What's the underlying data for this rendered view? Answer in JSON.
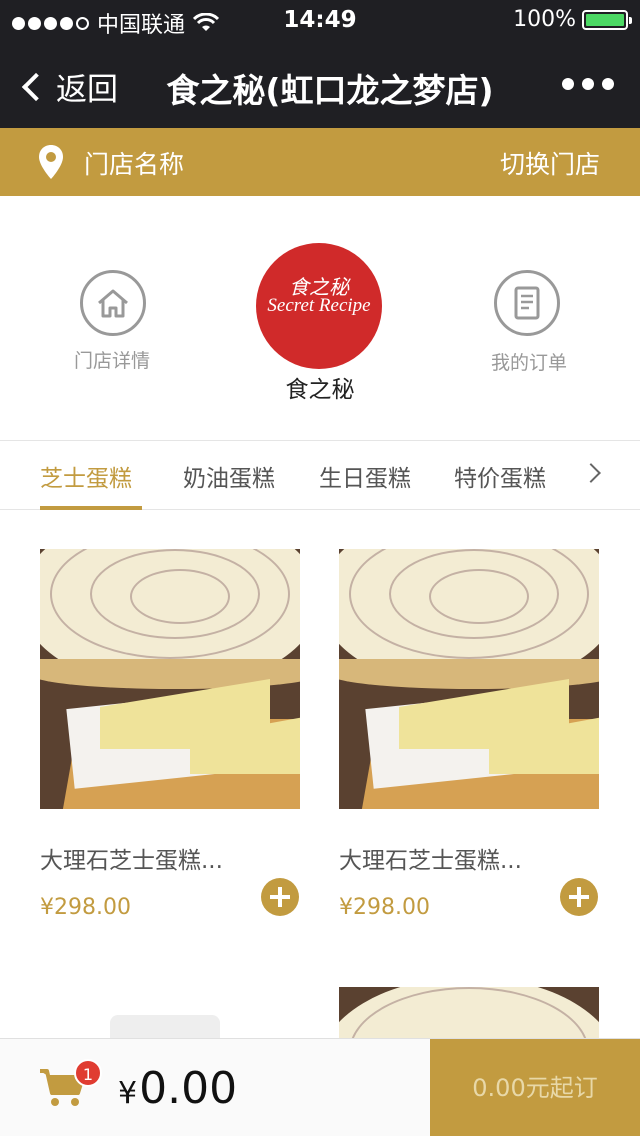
{
  "status_bar": {
    "carrier": "中国联通",
    "time": "14:49",
    "battery": "100%",
    "signal_bars": 4
  },
  "nav": {
    "back_label": "返回",
    "title": "食之秘(虹口龙之梦店)"
  },
  "store_bar": {
    "store_name": "门店名称",
    "switch_label": "切换门店"
  },
  "header": {
    "store_detail_label": "门店详情",
    "my_orders_label": "我的订单",
    "logo_cn": "食之秘",
    "logo_en": "Secret Recipe",
    "brand_name": "食之秘"
  },
  "tabs": [
    {
      "label": "芝士蛋糕",
      "active": true
    },
    {
      "label": "奶油蛋糕",
      "active": false
    },
    {
      "label": "生日蛋糕",
      "active": false
    },
    {
      "label": "特价蛋糕",
      "active": false
    }
  ],
  "products": [
    {
      "name": "大理石芝士蛋糕...",
      "price": "¥298.00"
    },
    {
      "name": "大理石芝士蛋糕...",
      "price": "¥298.00"
    }
  ],
  "cart": {
    "count": "1",
    "currency": "¥",
    "total": "0.00",
    "checkout_label": "0.00元起订"
  },
  "colors": {
    "accent": "#c29b40",
    "nav_bg": "#1f1f23",
    "badge": "#e03c31",
    "logo_red": "#d02a2a"
  }
}
